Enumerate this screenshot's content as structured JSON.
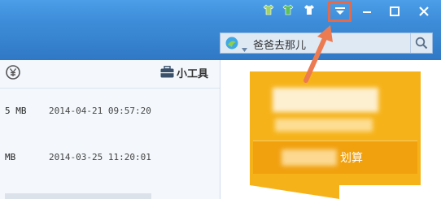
{
  "window": {
    "skin_icons": [
      "shirt-icon",
      "shirt-icon",
      "shirt-icon"
    ],
    "controls": [
      "dropdown-icon",
      "minimize-icon",
      "maximize-icon",
      "close-icon"
    ]
  },
  "search": {
    "text": "爸爸去那儿",
    "icon": "search-icon"
  },
  "panel": {
    "tools_label": "小工具",
    "rows": [
      {
        "size": "5 MB",
        "date": "2014-04-21 09:57:20"
      },
      {
        "size": "MB",
        "date": "2014-03-25 11:20:01"
      }
    ]
  },
  "banner": {
    "cta_tail": "划算"
  },
  "colors": {
    "titlebar": "#3b8ad8",
    "highlight": "#e56a4a",
    "banner": "#f6b319"
  }
}
